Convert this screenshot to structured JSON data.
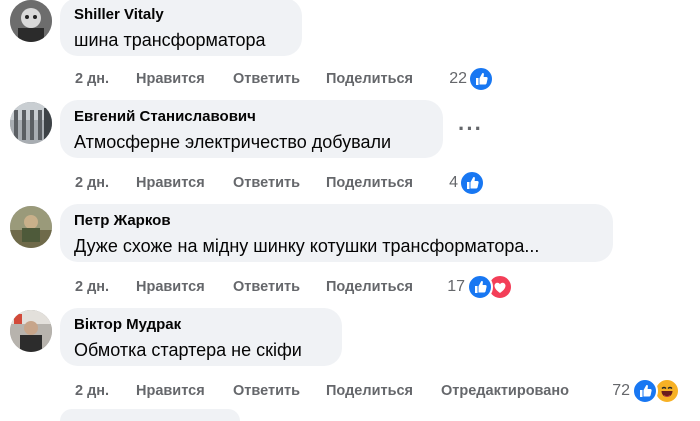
{
  "comments": [
    {
      "author": "Shiller Vitaly",
      "text": "шина трансформатора",
      "time": "2 дн.",
      "like": "Нравится",
      "reply": "Ответить",
      "share": "Поделиться",
      "edited": "",
      "reaction_count": "22",
      "reactions": [
        "like-icon"
      ]
    },
    {
      "author": "Евгений Станиславович",
      "text": "Атмосферне электричество добували",
      "time": "2 дн.",
      "like": "Нравится",
      "reply": "Ответить",
      "share": "Поделиться",
      "edited": "",
      "reaction_count": "4",
      "reactions": [
        "like-icon"
      ],
      "more": "···"
    },
    {
      "author": "Петр Жарков",
      "text": "Дуже схоже на мідну шинку котушки трансформатора...",
      "time": "2 дн.",
      "like": "Нравится",
      "reply": "Ответить",
      "share": "Поделиться",
      "edited": "",
      "reaction_count": "17",
      "reactions": [
        "like-icon",
        "love-icon"
      ]
    },
    {
      "author": "Віктор Мудрак",
      "text": "Обмотка стартера не скіфи",
      "time": "2 дн.",
      "like": "Нравится",
      "reply": "Ответить",
      "share": "Поделиться",
      "edited": "Отредактировано",
      "reaction_count": "72",
      "reactions": [
        "like-icon",
        "haha-icon"
      ]
    }
  ],
  "colors": {
    "bubble": "#f0f2f5",
    "meta_text": "#65676b",
    "like_blue": "#1877f2",
    "love_red": "#f33e58",
    "haha_yellow": "#f7b125"
  }
}
